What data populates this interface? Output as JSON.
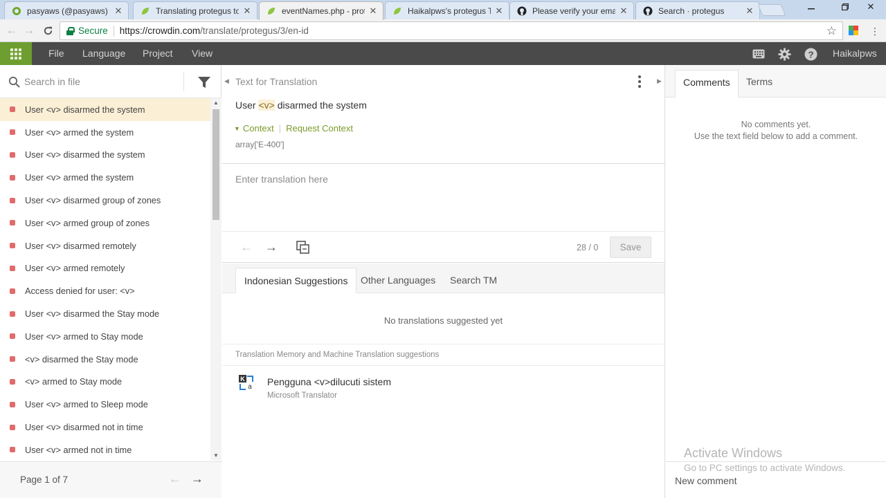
{
  "browser": {
    "tabs": [
      {
        "title": "pasyaws (@pasyaws) — T",
        "favicon": "crowdin-icon"
      },
      {
        "title": "Translating protegus to I",
        "favicon": "crowdin-leaf-icon"
      },
      {
        "title": "eventNames.php - prote",
        "favicon": "crowdin-leaf-icon",
        "active": true
      },
      {
        "title": "Haikalpws's protegus Tra",
        "favicon": "crowdin-leaf-icon"
      },
      {
        "title": "Please verify your email a",
        "favicon": "github-icon"
      },
      {
        "title": "Search · protegus",
        "favicon": "github-icon"
      }
    ],
    "secure_label": "Secure",
    "url_host": "https://crowdin.com",
    "url_path": "/translate/protegus/3/en-id"
  },
  "app": {
    "menu": [
      "File",
      "Language",
      "Project",
      "View"
    ],
    "user": "Haikalpws"
  },
  "left": {
    "search_placeholder": "Search in file",
    "strings": [
      "User <v> disarmed the system",
      "User <v> armed the system",
      "User <v> disarmed the system",
      "User <v> armed the system",
      "User <v> disarmed group of zones",
      "User <v> armed group of zones",
      "User <v> disarmed remotely",
      "User <v> armed remotely",
      "Access denied for user: <v>",
      "User <v> disarmed the Stay mode",
      "User <v> armed to Stay mode",
      "<v> disarmed the Stay mode",
      "<v> armed to Stay mode",
      "User <v> armed to Sleep mode",
      "User <v> disarmed not in time",
      "User <v> armed not in time"
    ],
    "selected_index": 0,
    "page_label": "Page 1 of 7"
  },
  "center": {
    "header": "Text for Translation",
    "source_before": "User ",
    "source_tag": "<v>",
    "source_after": " disarmed the system",
    "context_label": "Context",
    "request_context_label": "Request Context",
    "context_value": "array['E-400']",
    "translation_placeholder": "Enter translation here",
    "char_count": "28 / 0",
    "save_label": "Save",
    "suggestion_tabs": [
      "Indonesian Suggestions",
      "Other Languages",
      "Search TM"
    ],
    "no_suggestions": "No translations suggested yet",
    "tm_header": "Translation Memory and Machine Translation suggestions",
    "mt_text": "Pengguna <v>dilucuti sistem",
    "mt_source": "Microsoft Translator"
  },
  "right": {
    "tabs": [
      "Comments",
      "Terms"
    ],
    "no_comments": "No comments yet.",
    "no_comments_hint": "Use the text field below to add a comment.",
    "comment_placeholder": "New comment"
  },
  "watermark": {
    "title": "Activate Windows",
    "subtitle": "Go to PC settings to activate Windows."
  },
  "colors": {
    "accent_green": "#7b9a29",
    "apps_button": "#6e9e2f",
    "header_bg": "#4a4a4a",
    "selected_row": "#fbf0d6",
    "status_untranslated": "#e16b6b"
  }
}
